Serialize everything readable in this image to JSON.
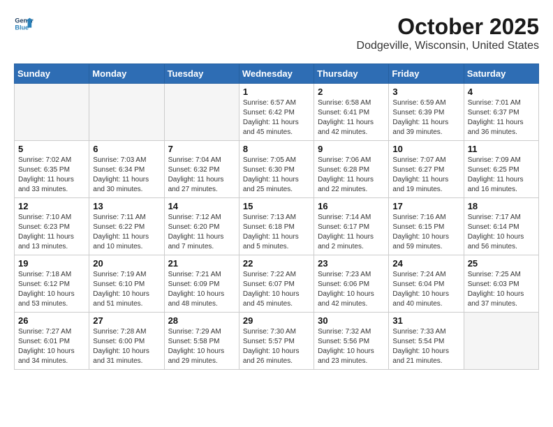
{
  "logo": {
    "line1": "General",
    "line2": "Blue"
  },
  "title": "October 2025",
  "subtitle": "Dodgeville, Wisconsin, United States",
  "headers": [
    "Sunday",
    "Monday",
    "Tuesday",
    "Wednesday",
    "Thursday",
    "Friday",
    "Saturday"
  ],
  "weeks": [
    [
      {
        "day": "",
        "sunrise": "",
        "sunset": "",
        "daylight": ""
      },
      {
        "day": "",
        "sunrise": "",
        "sunset": "",
        "daylight": ""
      },
      {
        "day": "",
        "sunrise": "",
        "sunset": "",
        "daylight": ""
      },
      {
        "day": "1",
        "sunrise": "Sunrise: 6:57 AM",
        "sunset": "Sunset: 6:42 PM",
        "daylight": "Daylight: 11 hours and 45 minutes."
      },
      {
        "day": "2",
        "sunrise": "Sunrise: 6:58 AM",
        "sunset": "Sunset: 6:41 PM",
        "daylight": "Daylight: 11 hours and 42 minutes."
      },
      {
        "day": "3",
        "sunrise": "Sunrise: 6:59 AM",
        "sunset": "Sunset: 6:39 PM",
        "daylight": "Daylight: 11 hours and 39 minutes."
      },
      {
        "day": "4",
        "sunrise": "Sunrise: 7:01 AM",
        "sunset": "Sunset: 6:37 PM",
        "daylight": "Daylight: 11 hours and 36 minutes."
      }
    ],
    [
      {
        "day": "5",
        "sunrise": "Sunrise: 7:02 AM",
        "sunset": "Sunset: 6:35 PM",
        "daylight": "Daylight: 11 hours and 33 minutes."
      },
      {
        "day": "6",
        "sunrise": "Sunrise: 7:03 AM",
        "sunset": "Sunset: 6:34 PM",
        "daylight": "Daylight: 11 hours and 30 minutes."
      },
      {
        "day": "7",
        "sunrise": "Sunrise: 7:04 AM",
        "sunset": "Sunset: 6:32 PM",
        "daylight": "Daylight: 11 hours and 27 minutes."
      },
      {
        "day": "8",
        "sunrise": "Sunrise: 7:05 AM",
        "sunset": "Sunset: 6:30 PM",
        "daylight": "Daylight: 11 hours and 25 minutes."
      },
      {
        "day": "9",
        "sunrise": "Sunrise: 7:06 AM",
        "sunset": "Sunset: 6:28 PM",
        "daylight": "Daylight: 11 hours and 22 minutes."
      },
      {
        "day": "10",
        "sunrise": "Sunrise: 7:07 AM",
        "sunset": "Sunset: 6:27 PM",
        "daylight": "Daylight: 11 hours and 19 minutes."
      },
      {
        "day": "11",
        "sunrise": "Sunrise: 7:09 AM",
        "sunset": "Sunset: 6:25 PM",
        "daylight": "Daylight: 11 hours and 16 minutes."
      }
    ],
    [
      {
        "day": "12",
        "sunrise": "Sunrise: 7:10 AM",
        "sunset": "Sunset: 6:23 PM",
        "daylight": "Daylight: 11 hours and 13 minutes."
      },
      {
        "day": "13",
        "sunrise": "Sunrise: 7:11 AM",
        "sunset": "Sunset: 6:22 PM",
        "daylight": "Daylight: 11 hours and 10 minutes."
      },
      {
        "day": "14",
        "sunrise": "Sunrise: 7:12 AM",
        "sunset": "Sunset: 6:20 PM",
        "daylight": "Daylight: 11 hours and 7 minutes."
      },
      {
        "day": "15",
        "sunrise": "Sunrise: 7:13 AM",
        "sunset": "Sunset: 6:18 PM",
        "daylight": "Daylight: 11 hours and 5 minutes."
      },
      {
        "day": "16",
        "sunrise": "Sunrise: 7:14 AM",
        "sunset": "Sunset: 6:17 PM",
        "daylight": "Daylight: 11 hours and 2 minutes."
      },
      {
        "day": "17",
        "sunrise": "Sunrise: 7:16 AM",
        "sunset": "Sunset: 6:15 PM",
        "daylight": "Daylight: 10 hours and 59 minutes."
      },
      {
        "day": "18",
        "sunrise": "Sunrise: 7:17 AM",
        "sunset": "Sunset: 6:14 PM",
        "daylight": "Daylight: 10 hours and 56 minutes."
      }
    ],
    [
      {
        "day": "19",
        "sunrise": "Sunrise: 7:18 AM",
        "sunset": "Sunset: 6:12 PM",
        "daylight": "Daylight: 10 hours and 53 minutes."
      },
      {
        "day": "20",
        "sunrise": "Sunrise: 7:19 AM",
        "sunset": "Sunset: 6:10 PM",
        "daylight": "Daylight: 10 hours and 51 minutes."
      },
      {
        "day": "21",
        "sunrise": "Sunrise: 7:21 AM",
        "sunset": "Sunset: 6:09 PM",
        "daylight": "Daylight: 10 hours and 48 minutes."
      },
      {
        "day": "22",
        "sunrise": "Sunrise: 7:22 AM",
        "sunset": "Sunset: 6:07 PM",
        "daylight": "Daylight: 10 hours and 45 minutes."
      },
      {
        "day": "23",
        "sunrise": "Sunrise: 7:23 AM",
        "sunset": "Sunset: 6:06 PM",
        "daylight": "Daylight: 10 hours and 42 minutes."
      },
      {
        "day": "24",
        "sunrise": "Sunrise: 7:24 AM",
        "sunset": "Sunset: 6:04 PM",
        "daylight": "Daylight: 10 hours and 40 minutes."
      },
      {
        "day": "25",
        "sunrise": "Sunrise: 7:25 AM",
        "sunset": "Sunset: 6:03 PM",
        "daylight": "Daylight: 10 hours and 37 minutes."
      }
    ],
    [
      {
        "day": "26",
        "sunrise": "Sunrise: 7:27 AM",
        "sunset": "Sunset: 6:01 PM",
        "daylight": "Daylight: 10 hours and 34 minutes."
      },
      {
        "day": "27",
        "sunrise": "Sunrise: 7:28 AM",
        "sunset": "Sunset: 6:00 PM",
        "daylight": "Daylight: 10 hours and 31 minutes."
      },
      {
        "day": "28",
        "sunrise": "Sunrise: 7:29 AM",
        "sunset": "Sunset: 5:58 PM",
        "daylight": "Daylight: 10 hours and 29 minutes."
      },
      {
        "day": "29",
        "sunrise": "Sunrise: 7:30 AM",
        "sunset": "Sunset: 5:57 PM",
        "daylight": "Daylight: 10 hours and 26 minutes."
      },
      {
        "day": "30",
        "sunrise": "Sunrise: 7:32 AM",
        "sunset": "Sunset: 5:56 PM",
        "daylight": "Daylight: 10 hours and 23 minutes."
      },
      {
        "day": "31",
        "sunrise": "Sunrise: 7:33 AM",
        "sunset": "Sunset: 5:54 PM",
        "daylight": "Daylight: 10 hours and 21 minutes."
      },
      {
        "day": "",
        "sunrise": "",
        "sunset": "",
        "daylight": ""
      }
    ]
  ]
}
